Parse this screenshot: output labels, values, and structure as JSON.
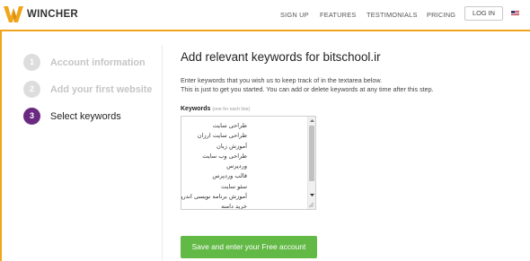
{
  "header": {
    "brand": "WINCHER",
    "nav": [
      {
        "label": "SIGN UP"
      },
      {
        "label": "FEATURES"
      },
      {
        "label": "TESTIMONIALS"
      },
      {
        "label": "PRICING"
      }
    ],
    "login_label": "LOG IN",
    "flag_icon": "us-flag-icon"
  },
  "colors": {
    "accent": "#f2a41a",
    "active_step": "#6a2a82",
    "button": "#63b946"
  },
  "steps": [
    {
      "number": "1",
      "label": "Account information",
      "active": false
    },
    {
      "number": "2",
      "label": "Add your first website",
      "active": false
    },
    {
      "number": "3",
      "label": "Select keywords",
      "active": true
    }
  ],
  "main": {
    "title": "Add relevant keywords for bitschool.ir",
    "description_line1": "Enter keywords that you wish us to keep track of in the textarea below.",
    "description_line2": "This is just to get you started. You can add or delete keywords at any time after this step.",
    "keywords_label": "Keywords",
    "keywords_hint": "(one for each line)",
    "keywords": [
      "طراحی سایت",
      "طراحی سایت ارزان",
      "آموزش زبان",
      "طراحی وب سایت",
      "وردپرس",
      "قالب وردپرس",
      "سئو سایت",
      "آموزش برنامه نویسی اندروید",
      "خرید دامنه"
    ],
    "submit_label": "Save and enter your Free account"
  }
}
